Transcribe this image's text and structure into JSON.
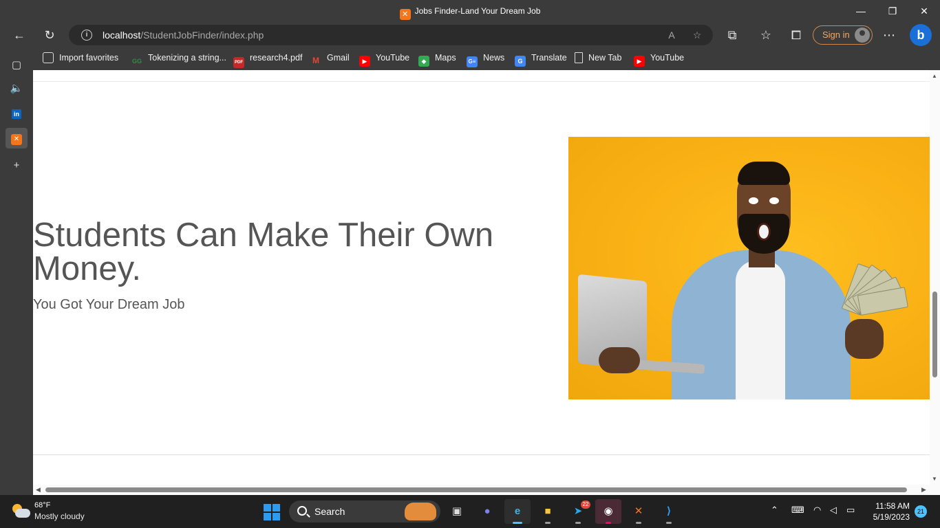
{
  "window": {
    "title": "Jobs Finder-Land Your Dream Job",
    "favicon": "xampp-icon",
    "controls": [
      "minimize",
      "restore",
      "close"
    ]
  },
  "address_bar": {
    "host": "localhost",
    "path": "/StudentJobFinder/index.php",
    "sign_in_label": "Sign in"
  },
  "favorites": [
    {
      "label": "Import favorites",
      "icon": "import-icon"
    },
    {
      "label": "Tokenizing a string...",
      "icon": "geeksforgeeks-icon"
    },
    {
      "label": "research4.pdf",
      "icon": "pdf-icon"
    },
    {
      "label": "Gmail",
      "icon": "gmail-icon"
    },
    {
      "label": "YouTube",
      "icon": "youtube-icon"
    },
    {
      "label": "Maps",
      "icon": "maps-icon"
    },
    {
      "label": "News",
      "icon": "news-icon"
    },
    {
      "label": "Translate",
      "icon": "translate-icon"
    },
    {
      "label": "New Tab",
      "icon": "page-icon"
    },
    {
      "label": "YouTube",
      "icon": "youtube-icon"
    }
  ],
  "page": {
    "headline": "Students Can Make Their Own Money.",
    "subheadline": "You Got Your Dream Job",
    "hero_image": "man-with-laptop-and-money"
  },
  "taskbar": {
    "weather_temp": "68°F",
    "weather_desc": "Mostly cloudy",
    "search_label": "Search",
    "telegram_badge": "22",
    "time": "11:58 AM",
    "date": "5/19/2023",
    "notification_count": "21"
  },
  "colors": {
    "accent_taskbar": "#4cc2ff",
    "hero_background": "#f9b014",
    "text_gray": "#555555",
    "sign_in": "#f0a868"
  }
}
